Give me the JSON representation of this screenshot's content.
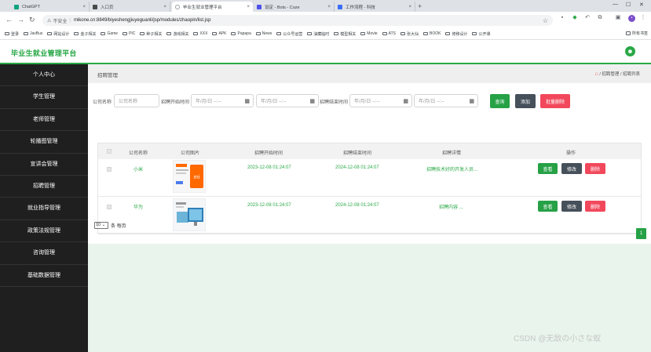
{
  "browser": {
    "tabs": [
      {
        "title": "ChatGPT",
        "color": "#10a37f",
        "active": false
      },
      {
        "title": "入口页",
        "color": "#4a4a4a",
        "active": false
      },
      {
        "title": "毕业生就业管理平台",
        "color": "#9aa0a6",
        "active": true
      },
      {
        "title": "设定 - Bots - Coze",
        "color": "#4d53e8",
        "active": false
      },
      {
        "title": "工作流程 - 科技",
        "color": "#3b6ef5",
        "active": false
      }
    ],
    "new_tab": "+",
    "security_label": "不安全",
    "url": "mikone.cn:8849/biyeshengjiuyeguanli/jsp/modules/zhaopin/list.jsp",
    "bookmarks": [
      "登录",
      "JavBus",
      "网站设计",
      "金子相关",
      "Game",
      "PIC",
      "种子相关",
      "游戏相关",
      "XXX",
      "APK",
      "Papapa",
      "News",
      "公众号运营",
      "油藏临时",
      "模型相关",
      "Movie",
      "ATS",
      "张大仙",
      "BOOK",
      "修移设计",
      "公开课"
    ],
    "bookmarks_all": "所有书签"
  },
  "app": {
    "title": "毕业生就业管理平台"
  },
  "sidebar": {
    "items": [
      {
        "label": "个人中心"
      },
      {
        "label": "学生管理"
      },
      {
        "label": "老师管理"
      },
      {
        "label": "轮播图管理"
      },
      {
        "label": "宣讲会管理"
      },
      {
        "label": "招聘管理"
      },
      {
        "label": "就业指导管理"
      },
      {
        "label": "政策法规管理"
      },
      {
        "label": "咨询管理"
      },
      {
        "label": "基础数据管理"
      }
    ]
  },
  "breadcrumb": {
    "title": "招聘管理",
    "sep": "/",
    "level1": "招聘管理",
    "level2": "招聘列表"
  },
  "search": {
    "company_label": "公司名称",
    "company_placeholder": "公司名称",
    "start_label": "招聘开始时间",
    "end_label": "招聘结束时间",
    "date_placeholder": "年/月/日 --:--",
    "query_button": "查询",
    "add_button": "添加",
    "batch_delete_button": "批量删除"
  },
  "table": {
    "headers": [
      "公司名称",
      "公司图片",
      "招聘开始时间",
      "招聘结束时间",
      "招聘详情",
      "操作"
    ],
    "rows": [
      {
        "company": "小米",
        "start": "2023-12-08 01:24:07",
        "end": "2024-12-08 01:24:07",
        "detail": "招聘技术好的开发人员...",
        "logo_text": "mi"
      },
      {
        "company": "华为",
        "start": "2023-12-08 01:24:07",
        "end": "2024-12-08 01:24:07",
        "detail": "招聘内容 ...",
        "logo_text": ""
      }
    ],
    "actions": {
      "view": "查看",
      "edit": "修改",
      "delete": "删除"
    }
  },
  "pagination": {
    "page_size": "10",
    "page_size_suffix": "条 每页",
    "current_page": "1"
  },
  "watermark": "CSDN @无敌の小さな蚁",
  "colors": {
    "accent": "#29a846",
    "sidebar_bg": "#1f1f1f",
    "danger": "#f2485b",
    "dark_button": "#45505a"
  }
}
